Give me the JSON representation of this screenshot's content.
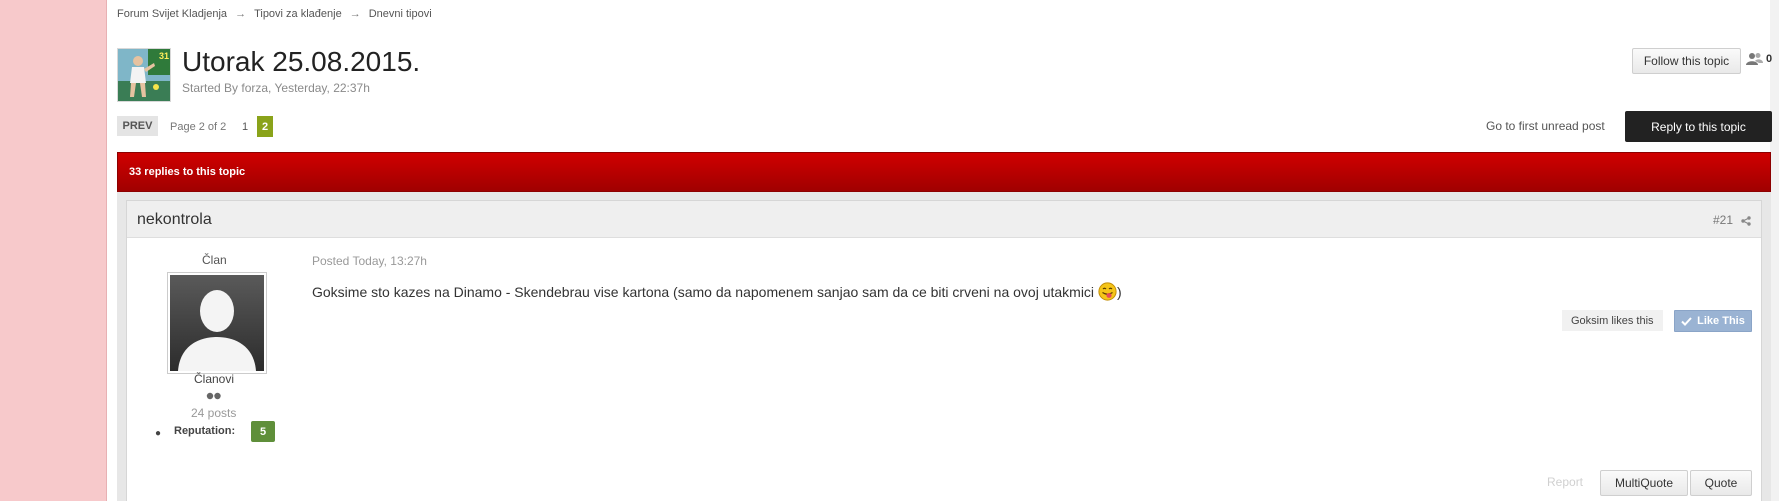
{
  "breadcrumb": {
    "items": [
      "Forum Svijet Kladjenja",
      "Tipovi za klađenje",
      "Dnevni tipovi"
    ],
    "separator": "→"
  },
  "topic": {
    "title": "Utorak 25.08.2015.",
    "meta": "Started By forza, Yesterday, 22:37h",
    "thumb_number": "31",
    "follow_label": "Follow this topic",
    "follower_count": "0"
  },
  "pagination": {
    "prev_label": "PREV",
    "page_info": "Page 2 of 2",
    "pages": [
      "1",
      "2"
    ],
    "current_page": "2"
  },
  "actions": {
    "first_unread_label": "Go to first unread post",
    "reply_label": "Reply to this topic"
  },
  "replies_bar": {
    "text": "33 replies to this topic"
  },
  "post": {
    "author": "nekontrola",
    "number": "#21",
    "user_group": "Član",
    "member_title": "Članovi",
    "post_count": "24 posts",
    "reputation_label": "Reputation:",
    "reputation_value": "5",
    "posted": "Posted Today, 13:27h",
    "body": "Goksime sto kazes na Dinamo - Skendebrau vise kartona (samo da napomenem sanjao sam da ce biti crveni na ovoj utakmici",
    "body_end": ")",
    "likes_text": "Goksim likes this",
    "like_button": "Like This",
    "report_label": "Report",
    "multiquote_label": "MultiQuote",
    "quote_label": "Quote"
  },
  "colors": {
    "accent_red": "#c00000",
    "page_active": "#8aa31a",
    "reputation": "#5f8f3a",
    "like_button": "#9ab3d3"
  },
  "icons": [
    "followers-icon",
    "share-icon",
    "default-avatar-icon",
    "tongue-smiley-icon",
    "checkmark-icon"
  ]
}
